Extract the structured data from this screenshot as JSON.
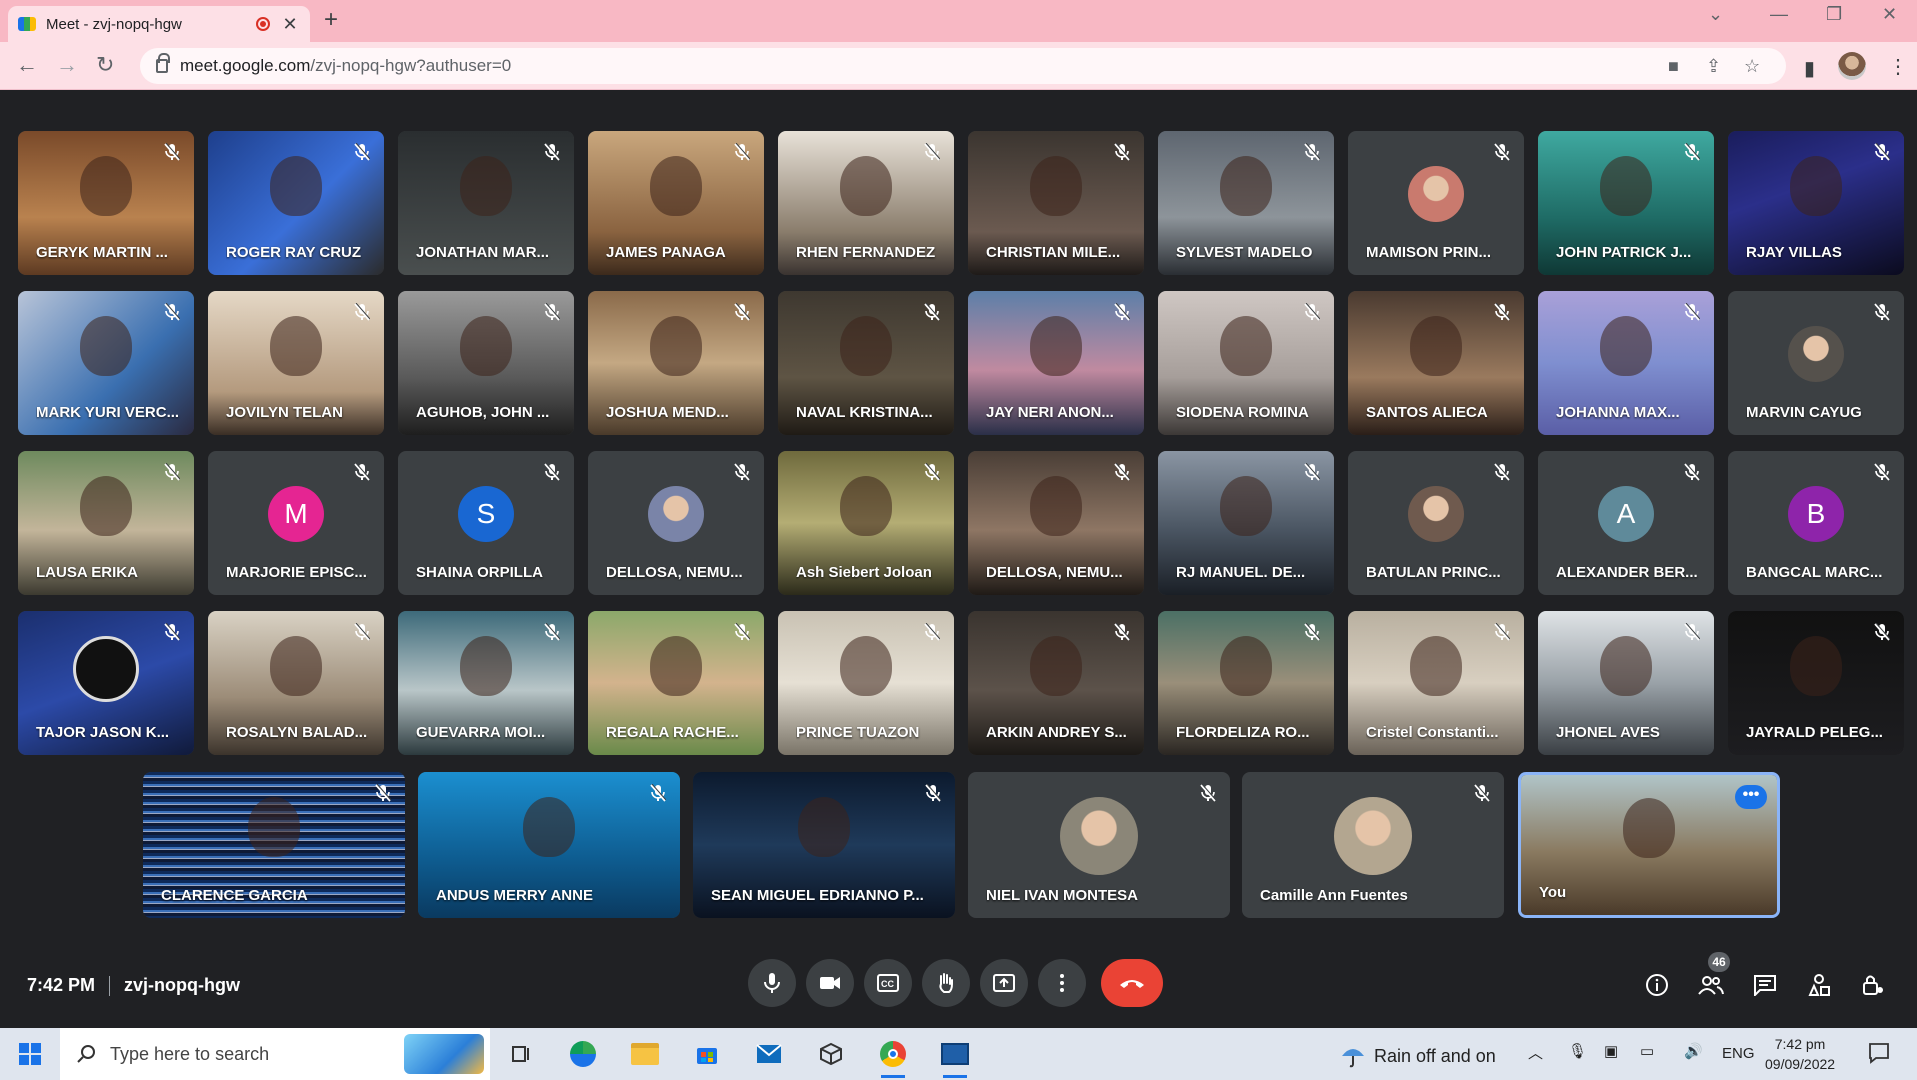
{
  "browser": {
    "tab_title": "Meet - zvj-nopq-hgw",
    "url_host": "meet.google.com",
    "url_path": "/zvj-nopq-hgw?authuser=0"
  },
  "meeting": {
    "time": "7:42 PM",
    "code": "zvj-nopq-hgw",
    "participant_count": "46"
  },
  "participants": [
    {
      "name": "GERYK MARTIN ..."
    },
    {
      "name": "ROGER RAY CRUZ"
    },
    {
      "name": "JONATHAN MAR..."
    },
    {
      "name": "JAMES PANAGA"
    },
    {
      "name": "RHEN FERNANDEZ"
    },
    {
      "name": "CHRISTIAN MILE..."
    },
    {
      "name": "SYLVEST MADELO"
    },
    {
      "name": "MAMISON PRIN..."
    },
    {
      "name": "JOHN PATRICK J..."
    },
    {
      "name": "RJAY VILLAS"
    },
    {
      "name": "MARK YURI VERC..."
    },
    {
      "name": "JOVILYN TELAN"
    },
    {
      "name": "AGUHOB, JOHN ..."
    },
    {
      "name": "JOSHUA MEND..."
    },
    {
      "name": "NAVAL KRISTINA..."
    },
    {
      "name": "JAY NERI ANON..."
    },
    {
      "name": "SIODENA ROMINA"
    },
    {
      "name": "SANTOS ALIECA"
    },
    {
      "name": "JOHANNA MAX..."
    },
    {
      "name": "MARVIN CAYUG"
    },
    {
      "name": "LAUSA ERIKA"
    },
    {
      "name": "MARJORIE EPISC...",
      "initial": "M",
      "avatar_color": "#e52592"
    },
    {
      "name": "SHAINA ORPILLA",
      "initial": "S",
      "avatar_color": "#1967d2"
    },
    {
      "name": "DELLOSA, NEMU..."
    },
    {
      "name": "Ash Siebert Joloan"
    },
    {
      "name": "DELLOSA, NEMU..."
    },
    {
      "name": "RJ MANUEL. DE..."
    },
    {
      "name": "BATULAN PRINC..."
    },
    {
      "name": "ALEXANDER BER...",
      "initial": "A",
      "avatar_color": "#5f8a9a"
    },
    {
      "name": "BANGCAL MARC...",
      "initial": "B",
      "avatar_color": "#8e24aa"
    },
    {
      "name": "TAJOR JASON K..."
    },
    {
      "name": "ROSALYN BALAD..."
    },
    {
      "name": "GUEVARRA MOI..."
    },
    {
      "name": "REGALA RACHE..."
    },
    {
      "name": "PRINCE TUAZON"
    },
    {
      "name": "ARKIN ANDREY S..."
    },
    {
      "name": "FLORDELIZA RO..."
    },
    {
      "name": "Cristel Constanti..."
    },
    {
      "name": "JHONEL AVES"
    },
    {
      "name": "JAYRALD PELEG..."
    },
    {
      "name": "CLARENCE GARCIA"
    },
    {
      "name": "ANDUS MERRY ANNE"
    },
    {
      "name": "SEAN MIGUEL EDRIANNO P..."
    },
    {
      "name": "NIEL IVAN MONTESA"
    },
    {
      "name": "Camille Ann Fuentes"
    },
    {
      "name": "You"
    }
  ],
  "taskbar": {
    "search_placeholder": "Type here to search",
    "weather": "Rain off and on",
    "language": "ENG",
    "time": "7:42 pm",
    "date": "09/09/2022"
  },
  "colors": {
    "end_call": "#ea4335",
    "self_border": "#8ab4f8",
    "meet_bg": "#202124",
    "tile_bg": "#3c4043"
  }
}
